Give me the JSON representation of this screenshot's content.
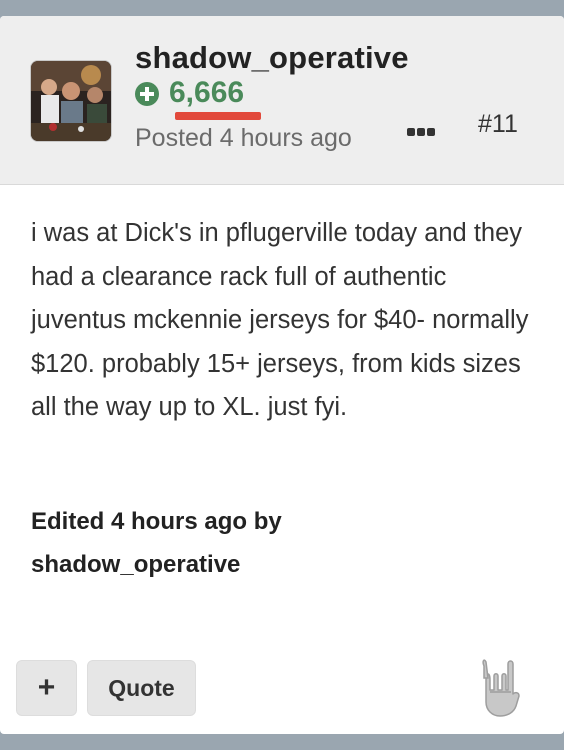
{
  "post": {
    "username": "shadow_operative",
    "reputation": "6,666",
    "posted": "Posted 4 hours ago",
    "post_number": "#11",
    "body": "i was at Dick's in pflugerville today and they had a clearance rack full of authentic juventus mckennie jerseys for $40- normally $120. probably 15+ jerseys, from kids sizes all the way up to XL. just fyi.",
    "edited_prefix": "Edited 4 hours ago by",
    "edited_by": "shadow_operative"
  },
  "actions": {
    "plus_label": "+",
    "quote_label": "Quote"
  },
  "icons": {
    "reputation": "plus-circle-icon",
    "more": "more-options-icon",
    "reaction": "rock-on-hand-icon"
  },
  "colors": {
    "reputation_green": "#4a8a5a",
    "highlight_red": "#e2493b",
    "header_bg": "#eeeeee"
  }
}
